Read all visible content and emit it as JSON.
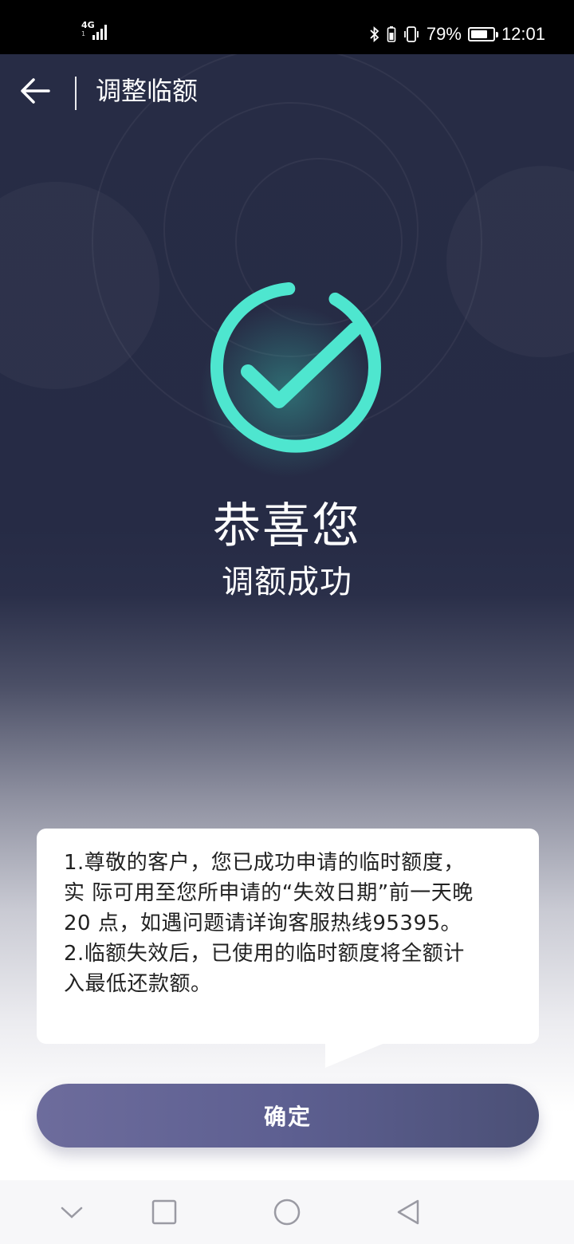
{
  "status_bar": {
    "network": "4G",
    "network_sub": "1",
    "battery_percent": "79%",
    "battery_level": 0.79,
    "time": "12:01",
    "icons": [
      "bluetooth-icon",
      "battery-small-icon",
      "vibrate-icon",
      "battery-icon"
    ]
  },
  "header": {
    "title": "调整临额",
    "back_icon": "back-arrow-icon"
  },
  "result": {
    "icon": "success-check-icon",
    "accent_color": "#4ee6cf",
    "headline": "恭喜您",
    "subtitle": "调额成功"
  },
  "notice": {
    "lines": [
      "1.尊敬的客户，您已成功申请的临时额度，",
      "实 际可用至您所申请的“失效日期”前一天晚",
      "20 点，如遇问题请详询客服热线95395。",
      "2.临额失效后，已使用的临时额度将全额计",
      "入最低还款额。"
    ]
  },
  "actions": {
    "confirm_label": "确定"
  },
  "navigation_bar": {
    "icons": [
      "collapse-chevron-icon",
      "recents-square-icon",
      "home-circle-icon",
      "back-triangle-icon"
    ]
  },
  "colors": {
    "hero_dark": "#262b45",
    "button_start": "#6d6c9c",
    "button_end": "#4b5076"
  }
}
